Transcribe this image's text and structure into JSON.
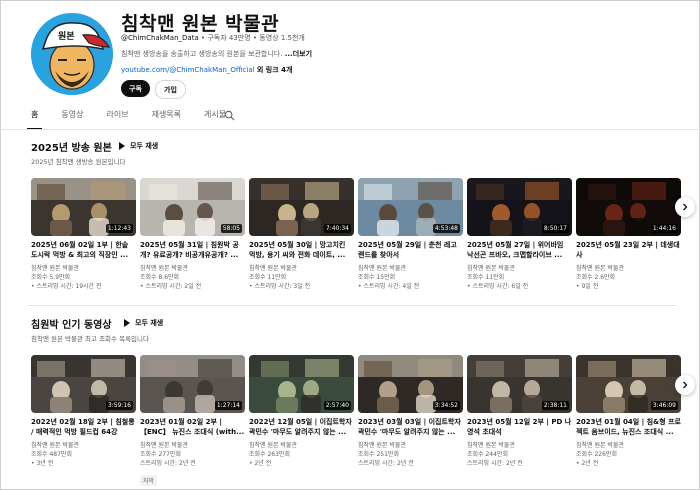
{
  "channel": {
    "avatar_text": "원본",
    "title": "침착맨 원본 박물관",
    "handle": "@ChimChakMan_Data",
    "subscribers": "구독자 43만명",
    "videos": "동영상 1.5천개",
    "description": "침착맨 생방송을 송출하고 생방송의 원본을 보관합니다.",
    "more_label": "...더보기",
    "link_url": "youtube.com/@ChimChakMan_Official",
    "link_extra": "외 링크 4개",
    "subscribe_label": "구독",
    "join_label": "가입"
  },
  "tabs": [
    {
      "label": "홈",
      "active": true
    },
    {
      "label": "동영상",
      "active": false
    },
    {
      "label": "라이브",
      "active": false
    },
    {
      "label": "재생목록",
      "active": false
    },
    {
      "label": "게시물",
      "active": false
    }
  ],
  "sections": [
    {
      "title": "2025년 방송 원본",
      "play_all": "모두 재생",
      "subtitle": "2025년 침착맨 생방송 원본입니다",
      "videos": [
        {
          "duration": "1:12:43",
          "title": "2025년 06월 02일 1부 | 한솥 도시락 먹방 & 최고의 직장인 ...",
          "channel": "침착맨 원본 박물관",
          "views": "조회수 5.9만회",
          "extra": "• 스트리밍 시간: 19시간 전"
        },
        {
          "duration": "58:05",
          "title": "2025년 05월 31일 | 침원박 공개? 유료공개? 비공개유공개? ...",
          "channel": "침착맨 원본 박물관",
          "views": "조회수 8.6만회",
          "extra": "• 스트리밍 시간: 2일 전"
        },
        {
          "duration": "7:40:34",
          "title": "2025년 05월 30일 | 망고치킨 먹방, 용기 씨와 전화 데이트, ...",
          "channel": "침착맨 원본 박물관",
          "views": "조회수 11만회",
          "extra": "• 스트리밍 시간: 3일 전"
        },
        {
          "duration": "4:53:48",
          "title": "2025년 05월 29일 | 춘천 레고랜드를 찾아서",
          "channel": "침착맨 원본 박물관",
          "views": "조회수 15만회",
          "extra": "• 스트리밍 시간: 4일 전"
        },
        {
          "duration": "8:50:17",
          "title": "2025년 05월 27일 | 위어바임 낙선곤 프바오, 크맵할라이브 ...",
          "channel": "침착맨 원본 박물관",
          "views": "조회수 11만회",
          "extra": "• 스트리밍 시간: 6일 전"
        },
        {
          "duration": "1:44:16",
          "title": "2025년 05월 23일 2부 | 데생대사",
          "channel": "침착맨 원본 박물관",
          "views": "조회수 2.6만회",
          "extra": "• 9일 전"
        }
      ]
    },
    {
      "title": "침원박 인기 동영상",
      "play_all": "모두 재생",
      "subtitle": "침착맨 원본 박물관 최고 조회수 목록입니다",
      "videos": [
        {
          "duration": "3:59:16",
          "title": "2022년 02월 18일 2부 | 침철롱 / 매력적인 먹방 필드컵 64강",
          "channel": "침착맨 원본 박물관",
          "views": "조회수 487만회",
          "extra": "• 3년 전"
        },
        {
          "duration": "1:27:14",
          "title": "2023년 01월 02일 2부 | 【ENC】 뉴진스 조대식 (with...",
          "channel": "침착맨 원본 박물관",
          "views": "조회수 277만회",
          "extra": "스트리밍 시간: 2년 전",
          "badge": "자막"
        },
        {
          "duration": "2:57:40",
          "title": "2022년 12월 05일 | 이집트학자 곽민수 '마무도 알려주지 않는 ...",
          "channel": "침착맨 원본 박물관",
          "views": "조회수 263만회",
          "extra": "• 2년 전"
        },
        {
          "duration": "3:34:52",
          "title": "2023년 03월 03일 | 이집트학자 곽민수 '마무도 알려주지 않는 ...",
          "channel": "침착맨 원본 박물관",
          "views": "조회수 251만회",
          "extra": "스트리밍 시간: 2년 전"
        },
        {
          "duration": "2:38:11",
          "title": "2023년 05월 12일 2부 | PD 나영석 초대석",
          "channel": "침착맨 원본 박물관",
          "views": "조회수 244만회",
          "extra": "스트리밍 시간: 2년 전"
        },
        {
          "duration": "3:46:09",
          "title": "2023년 01월 04일 | 침&형 프로젝트 옴브이드, 뉴진스 조대식 ...",
          "channel": "침착맨 원본 박물관",
          "views": "조회수 226만회",
          "extra": "• 2년 전"
        }
      ]
    }
  ],
  "colors": {
    "link": "#065fd4",
    "avatar_bg": "#29a3e0",
    "subscribe_bg": "#0f0f0f"
  }
}
